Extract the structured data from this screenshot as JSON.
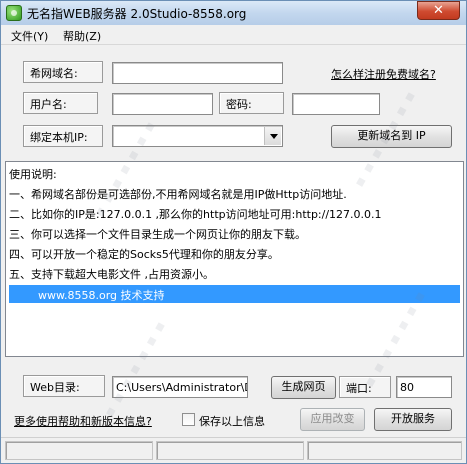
{
  "window": {
    "title": "无名指WEB服务器 2.0Studio-8558.org",
    "close_label": "✕"
  },
  "menu": {
    "file": "文件(Y)",
    "help": "帮助(Z)"
  },
  "domain_section": {
    "domain_label": "希网域名:",
    "domain_value": "",
    "register_link": "怎么样注册免费域名?",
    "username_label": "用户名:",
    "username_value": "",
    "password_label": "密码:",
    "password_value": "",
    "bind_ip_label": "绑定本机IP:",
    "bind_ip_value": "",
    "update_button": "更新域名到 IP"
  },
  "notes": {
    "lines": [
      "使用说明:",
      "一、希网域名部份是可选部份,不用希网域名就是用IP做Http访问地址.",
      "二、比如你的IP是:127.0.0.1 ,那么你的http访问地址可用:http://127.0.0.1",
      "三、你可以选择一个文件目录生成一个网页让你的朋友下载。",
      "四、可以开放一个稳定的Socks5代理和你的朋友分享。",
      "五、支持下载超大电影文件 ,占用资源小。"
    ],
    "highlight": "www.8558.org 技术支持"
  },
  "web_section": {
    "web_dir_label": "Web目录:",
    "web_dir_value": "C:\\Users\\Administrator\\Des",
    "generate_button": "生成网页",
    "port_label": "端口:",
    "port_value": "80",
    "help_link": "更多使用帮助和新版本信息?",
    "save_checkbox_label": "保存以上信息",
    "apply_button": "应用改变",
    "open_service_button": "开放服务"
  },
  "colors": {
    "selection": "#3399ff",
    "window_bg": "#f0f0f0"
  }
}
